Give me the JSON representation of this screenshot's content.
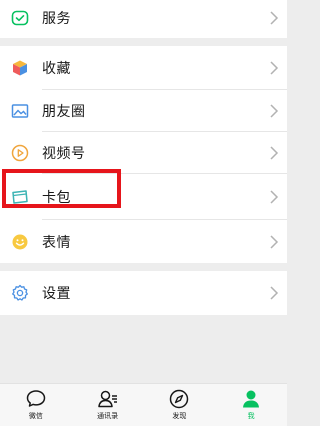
{
  "menu": {
    "services": {
      "label": "服务",
      "icon": "services-icon"
    },
    "favorites": {
      "label": "收藏",
      "icon": "favorites-cube-icon"
    },
    "moments": {
      "label": "朋友圈",
      "icon": "moments-picture-icon"
    },
    "channels": {
      "label": "视频号",
      "icon": "channels-play-icon"
    },
    "cards": {
      "label": "卡包",
      "icon": "card-wallet-icon"
    },
    "stickers": {
      "label": "表情",
      "icon": "stickers-smile-icon"
    },
    "settings": {
      "label": "设置",
      "icon": "settings-gear-icon"
    }
  },
  "tabbar": {
    "chats": {
      "label": "微信",
      "icon": "chat-bubble-icon"
    },
    "contacts": {
      "label": "通讯录",
      "icon": "contacts-icon"
    },
    "discover": {
      "label": "发现",
      "icon": "compass-icon"
    },
    "me": {
      "label": "我",
      "icon": "person-icon",
      "active": true
    }
  },
  "colors": {
    "accent": "#07c160",
    "highlight_box": "#e6151b",
    "background": "#ededed"
  }
}
